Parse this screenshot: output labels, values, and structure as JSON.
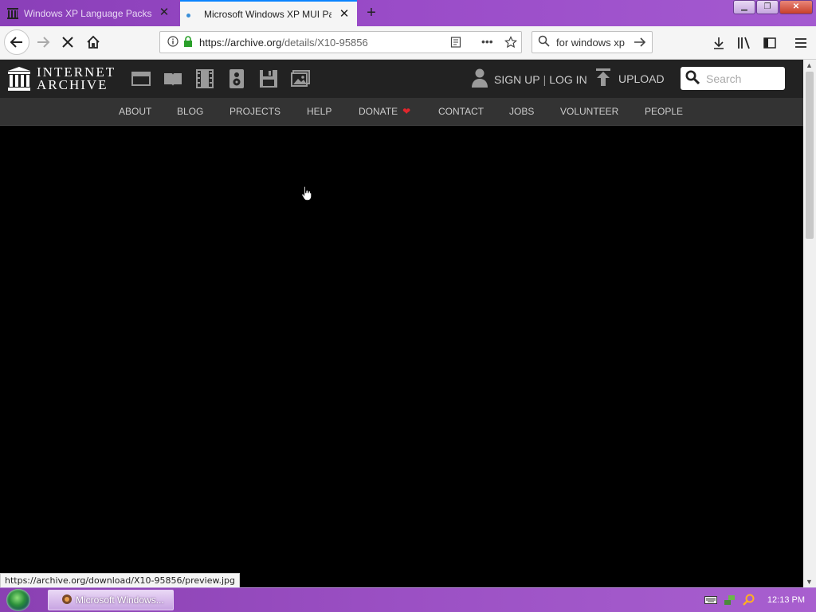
{
  "browser": {
    "tabs": [
      {
        "label": "Windows XP Language Packs : M"
      },
      {
        "label": "Microsoft Windows XP MUI Pac"
      }
    ],
    "url_host": "https://archive.org",
    "url_path": "/details/X10-95856",
    "search_value": "for windows xp",
    "status_url": "https://archive.org/download/X10-95856/preview.jpg"
  },
  "ia": {
    "logo_line1": "INTERNET",
    "logo_line2": "ARCHIVE",
    "sign_up": "SIGN UP",
    "separator": "|",
    "log_in": "LOG IN",
    "upload": "UPLOAD",
    "search_placeholder": "Search",
    "nav": [
      "ABOUT",
      "BLOG",
      "PROJECTS",
      "HELP",
      "DONATE",
      "CONTACT",
      "JOBS",
      "VOLUNTEER",
      "PEOPLE"
    ],
    "heart_color": "#e0262c"
  },
  "taskbar": {
    "window_label": "Microsoft Windows...",
    "clock": "12:13 PM"
  }
}
